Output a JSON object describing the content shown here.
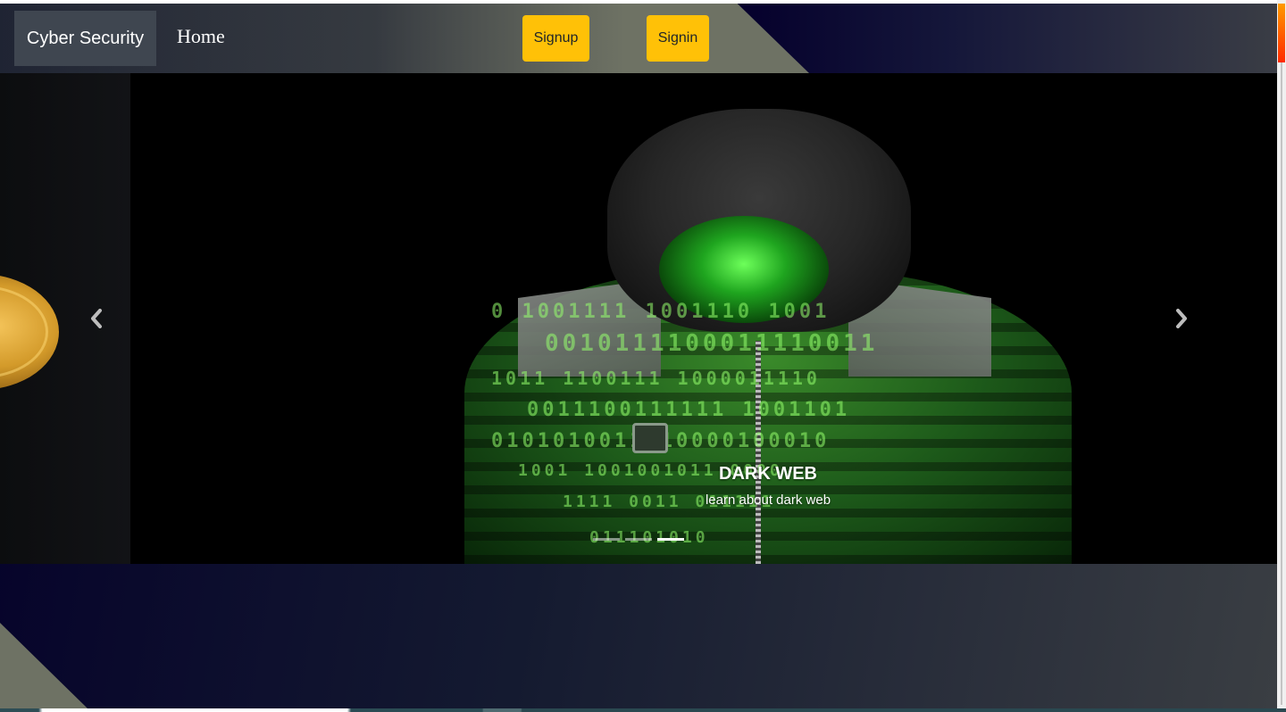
{
  "navbar": {
    "brand": "Cyber Security",
    "home_label": "Home",
    "signup_label": "Signup",
    "signin_label": "Signin"
  },
  "carousel": {
    "active_index": 2,
    "slide_count": 3,
    "caption": {
      "title": "DARK WEB",
      "subtitle": "learn about dark web"
    },
    "binary_rows": [
      "0  1001111  1001110  1001",
      "0010111100011110011",
      "1011  1100111  1000011110",
      "0011100111111  1001101",
      "0101010011010000100010",
      "1001  1001001011  0000",
      "1111  0011  011111",
      "011101010"
    ]
  },
  "colors": {
    "accent": "#ffc107",
    "brand_bg": "#3f4650",
    "scroll_thumb": "#ff6a00"
  }
}
